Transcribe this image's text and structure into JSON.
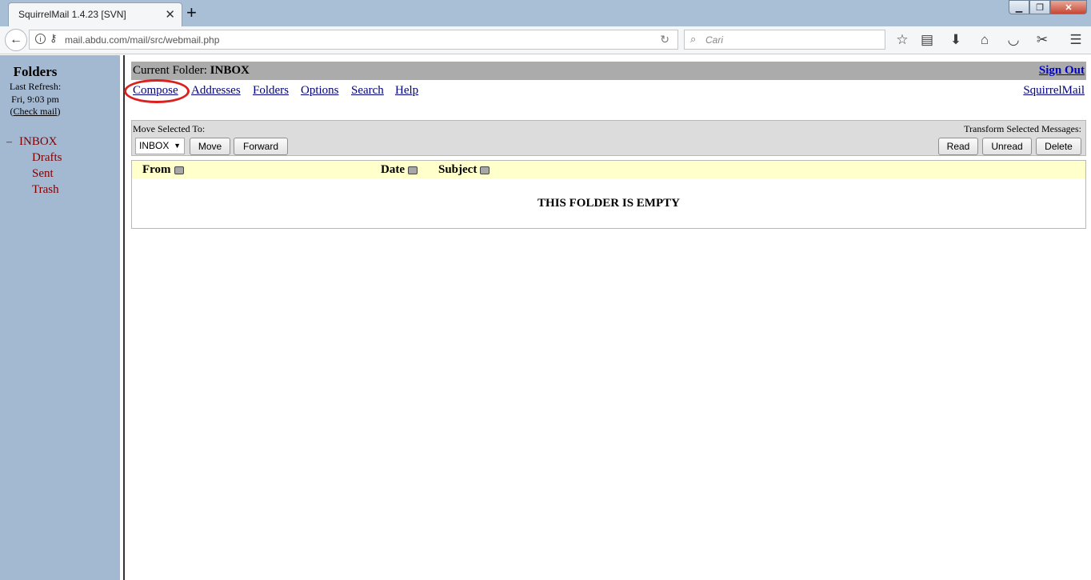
{
  "browser": {
    "tab_title": "SquirrelMail 1.4.23 [SVN]",
    "url": "mail.abdu.com/mail/src/webmail.php",
    "search_placeholder": "Cari",
    "icons": [
      "back-arrow-icon",
      "info-icon",
      "key-icon",
      "reload-icon",
      "search-icon",
      "bookmark-star-icon",
      "reading-list-icon",
      "download-icon",
      "home-icon",
      "pocket-icon",
      "screenshot-icon",
      "menu-icon"
    ]
  },
  "sidebar": {
    "title": "Folders",
    "last_refresh_label": "Last Refresh:",
    "last_refresh_time": "Fri, 9:03 pm",
    "check_mail_open": "(",
    "check_mail": "Check mail",
    "check_mail_close": ")",
    "toggle": "–",
    "folders": [
      "INBOX",
      "Drafts",
      "Sent",
      "Trash"
    ]
  },
  "main": {
    "current_folder_label": "Current Folder:",
    "current_folder": "INBOX",
    "sign_out": "Sign Out",
    "nav": [
      "Compose",
      "Addresses",
      "Folders",
      "Options",
      "Search",
      "Help"
    ],
    "brand_link": "SquirrelMail",
    "move_selected_label": "Move Selected To:",
    "transform_label": "Transform Selected Messages:",
    "move_target": "INBOX",
    "buttons": {
      "move": "Move",
      "forward": "Forward",
      "read": "Read",
      "unread": "Unread",
      "delete": "Delete"
    },
    "columns": [
      "From",
      "Date",
      "Subject"
    ],
    "empty_message": "THIS FOLDER IS EMPTY"
  },
  "colors": {
    "sidebar_bg": "#a3b9d2",
    "folder_link": "#800000",
    "header_bar": "#ababab",
    "table_header": "#ffffcc",
    "annotation_circle": "#d9221f"
  }
}
